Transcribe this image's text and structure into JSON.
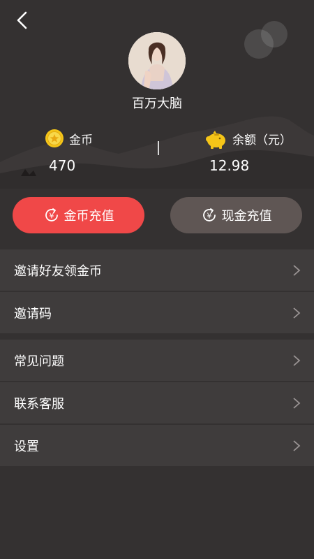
{
  "profile": {
    "nickname": "百万大脑"
  },
  "stats": {
    "coins": {
      "label": "金币",
      "value": "470",
      "icon": "gold-coin-icon"
    },
    "balance": {
      "label": "余额（元）",
      "value": "12.98",
      "icon": "piggy-bank-icon"
    }
  },
  "buttons": {
    "coin_recharge": "金币充值",
    "cash_recharge": "现金充值"
  },
  "menu": {
    "group1": [
      {
        "label": "邀请好友领金币"
      },
      {
        "label": "邀请码"
      }
    ],
    "group2": [
      {
        "label": "常见问题"
      },
      {
        "label": "联系客服"
      },
      {
        "label": "设置"
      }
    ]
  },
  "colors": {
    "background": "#343131",
    "menu_item": "#3f3c3c",
    "coin_button": "#f04848",
    "cash_button": "#5f5654",
    "gold": "#f5c518"
  }
}
